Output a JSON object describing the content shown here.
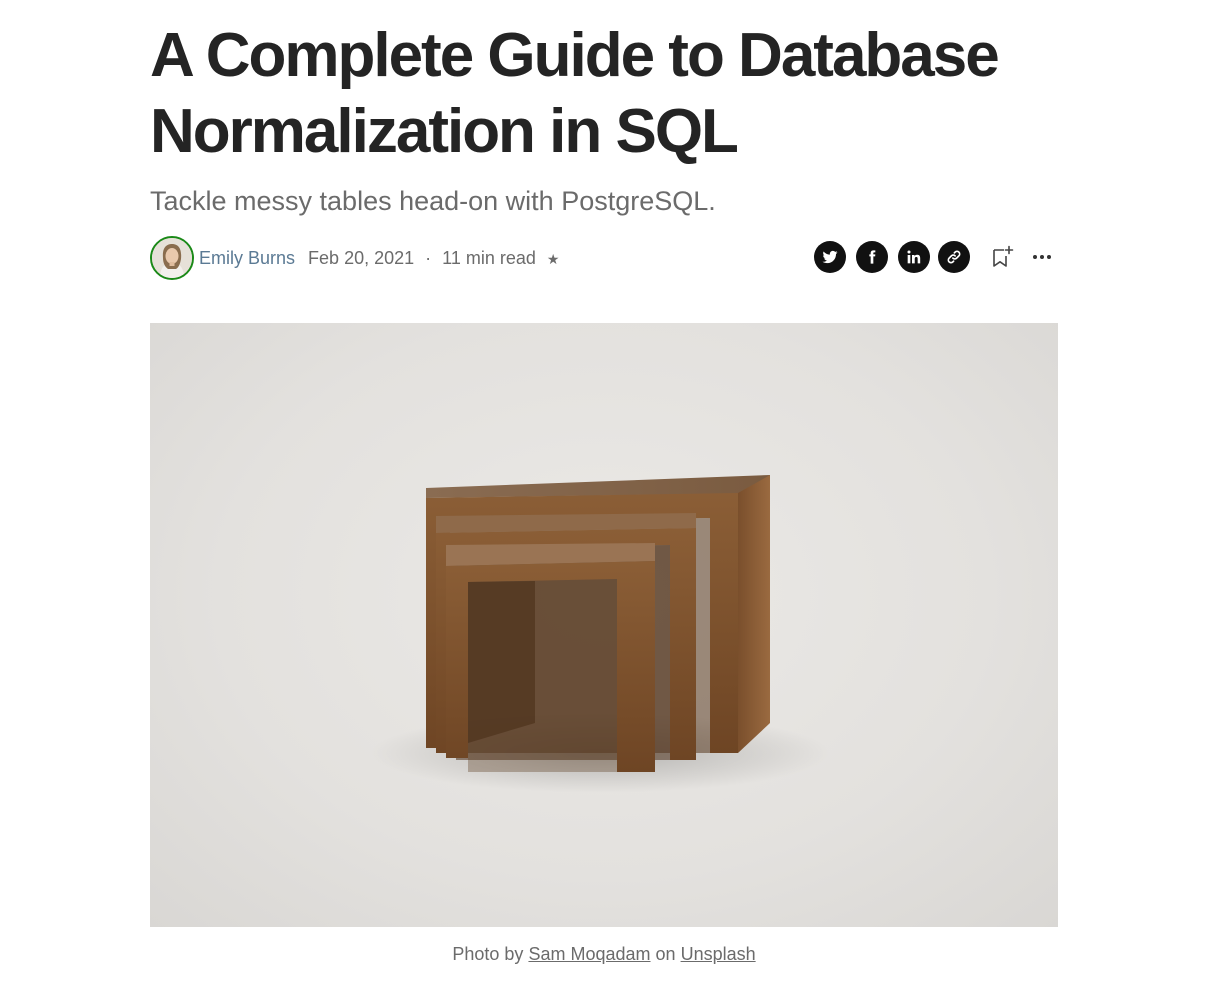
{
  "article": {
    "title": "A Complete Guide to Database Normalization in SQL",
    "subtitle": "Tackle messy tables head-on with PostgreSQL."
  },
  "meta": {
    "author_name": "Emily Burns",
    "date": "Feb 20, 2021",
    "separator": "·",
    "read_time": "11 min read",
    "member_star": "★"
  },
  "actions": {
    "icons": [
      "twitter-icon",
      "facebook-icon",
      "linkedin-icon",
      "link-icon",
      "bookmark-add-icon",
      "more-icon"
    ]
  },
  "hero": {
    "caption_prefix": "Photo by",
    "photographer": "Sam Moqadam",
    "caption_middle": "on",
    "source": "Unsplash"
  },
  "colors": {
    "text": "#242424",
    "muted": "#6b6b6b",
    "author_link": "#5b7a94",
    "avatar_ring": "#1a8917",
    "share_bg": "#111111"
  }
}
